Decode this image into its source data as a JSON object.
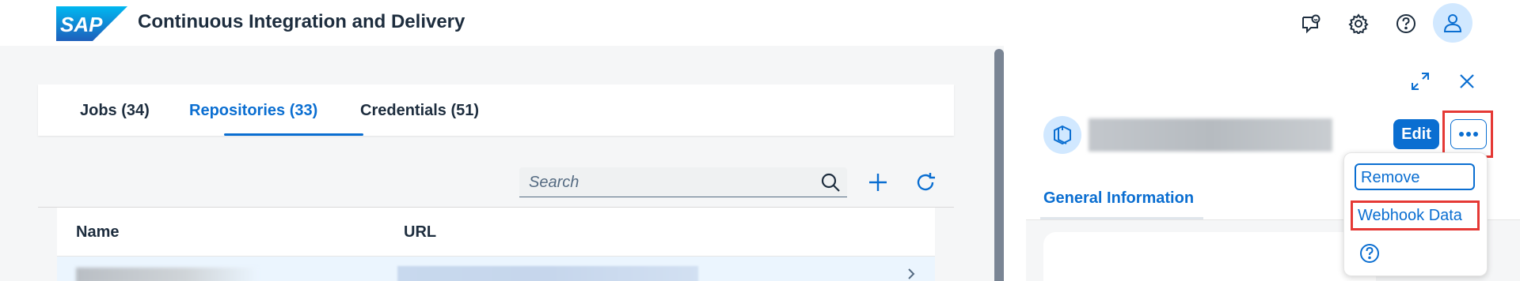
{
  "shell": {
    "logo_text": "SAP",
    "title": "Continuous Integration and Delivery",
    "icons": [
      "feedback-icon",
      "settings-icon",
      "help-icon",
      "user-icon"
    ]
  },
  "tabs": [
    {
      "label": "Jobs (34)",
      "active": false
    },
    {
      "label": "Repositories (33)",
      "active": true
    },
    {
      "label": "Credentials (51)",
      "active": false
    }
  ],
  "toolbar": {
    "search_placeholder": "Search"
  },
  "table": {
    "columns": [
      "Name",
      "URL"
    ]
  },
  "side_panel": {
    "edit_label": "Edit",
    "tab_label": "General Information"
  },
  "menu": {
    "items": [
      "Remove",
      "Webhook Data"
    ]
  },
  "colors": {
    "accent": "#0a6ed1",
    "highlight": "#e53935",
    "shell_background": "#ffffff",
    "page_background": "#f5f6f7"
  }
}
